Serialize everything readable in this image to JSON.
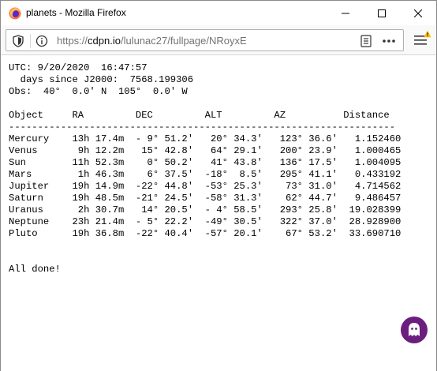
{
  "window": {
    "title": "planets - Mozilla Firefox"
  },
  "navbar": {
    "url_prefix": "https://",
    "url_domain": "cdpn.io",
    "url_path": "/lulunac27/fullpage/NRoyxE"
  },
  "output": {
    "utc_line": "UTC: 9/20/2020  16:47:57",
    "days_line": "  days since J2000:  7568.199306",
    "obs_line": "Obs:  40°  0.0' N  105°  0.0' W",
    "header_line": "Object     RA         DEC         ALT         AZ          Distance",
    "divider_line": "-------------------------------------------------------------------",
    "rows": [
      "Mercury    13h 17.4m  - 9° 51.2'   20° 34.3'   123° 36.6'   1.152460",
      "Venus       9h 12.2m   15° 42.8'   64° 29.1'   200° 23.9'   1.000465",
      "Sun        11h 52.3m    0° 50.2'   41° 43.8'   136° 17.5'   1.004095",
      "Mars        1h 46.3m    6° 37.5'  -18°  8.5'   295° 41.1'   0.433192",
      "Jupiter    19h 14.9m  -22° 44.8'  -53° 25.3'    73° 31.0'   4.714562",
      "Saturn     19h 48.5m  -21° 24.5'  -58° 31.3'    62° 44.7'   9.486457",
      "Uranus      2h 30.7m   14° 20.5'  - 4° 58.5'   293° 25.8'  19.028399",
      "Neptune    23h 21.4m  - 5° 22.2'  -49° 30.5'   322° 37.0'  28.928900",
      "Pluto      19h 36.8m  -22° 40.4'  -57° 20.1'    67° 53.2'  33.690710"
    ],
    "done_line": "All done!"
  },
  "colors": {
    "ghost_button": "#6b1e7e",
    "warning": "#ffbf00"
  }
}
